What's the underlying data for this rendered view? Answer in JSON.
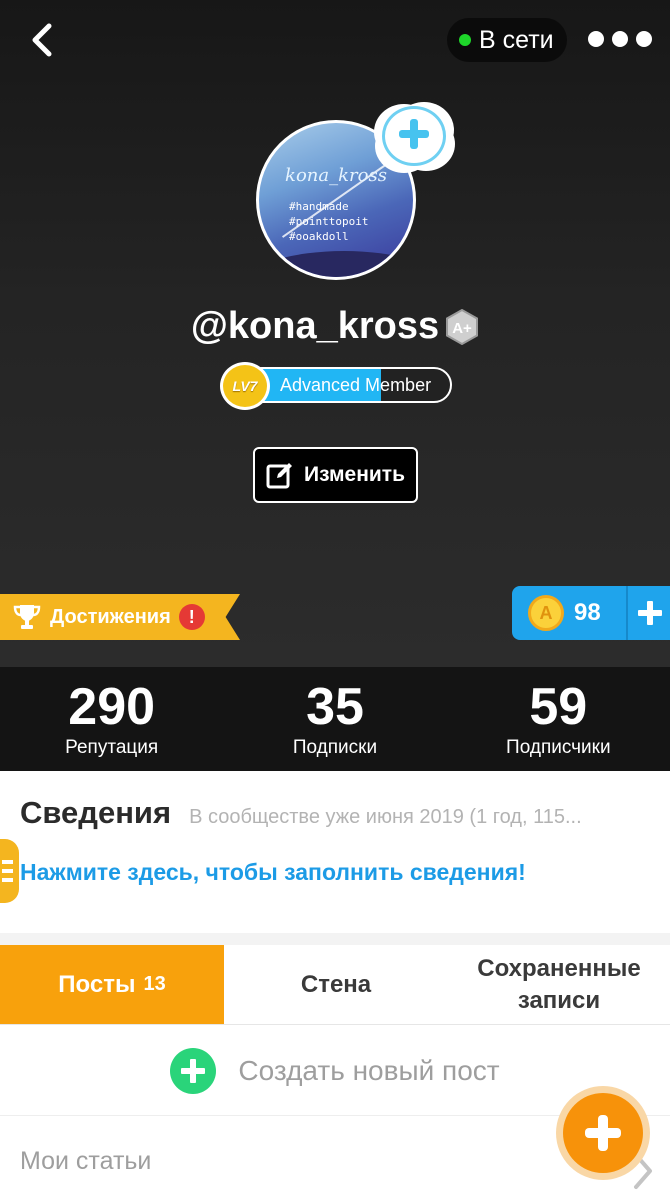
{
  "header": {
    "back_icon": "chevron-left-icon",
    "status_label": "В сети",
    "status_color": "#1ed62a",
    "more_icon": "more-dots-icon"
  },
  "profile": {
    "avatar_logo_text": "kona_kross",
    "avatar_tags": [
      "#handmade",
      "#pointtopoit",
      "#ooakdoll"
    ],
    "username": "@kona_kross",
    "hex_badge_icon": "a-plus-hex-icon",
    "level_badge": "LV7",
    "level_title": "Advanced Member",
    "level_progress": 0.66,
    "edit_label": "Изменить"
  },
  "achievements": {
    "label": "Достижения",
    "alert": "!"
  },
  "coins": {
    "coin_symbol": "A",
    "count": "98"
  },
  "stats": [
    {
      "value": "290",
      "label": "Репутация"
    },
    {
      "value": "35",
      "label": "Подписки"
    },
    {
      "value": "59",
      "label": "Подписчики"
    }
  ],
  "info": {
    "title": "Сведения",
    "since": "В сообществе уже июня 2019 (1 год, 115...",
    "cta": "Нажмите здесь, чтобы заполнить сведения!"
  },
  "tabs": {
    "posts_label": "Посты",
    "posts_count": "13",
    "wall_label": "Стена",
    "saved_label": "Сохраненные записи"
  },
  "create_post": {
    "label": "Создать новый пост"
  },
  "articles": {
    "label": "Мои статьи"
  },
  "colors": {
    "accent_orange": "#f8a10c",
    "accent_blue": "#1fa4ec",
    "link_blue": "#1c9be6",
    "achievements_yellow": "#f4b51f",
    "create_green": "#2ad47a"
  }
}
